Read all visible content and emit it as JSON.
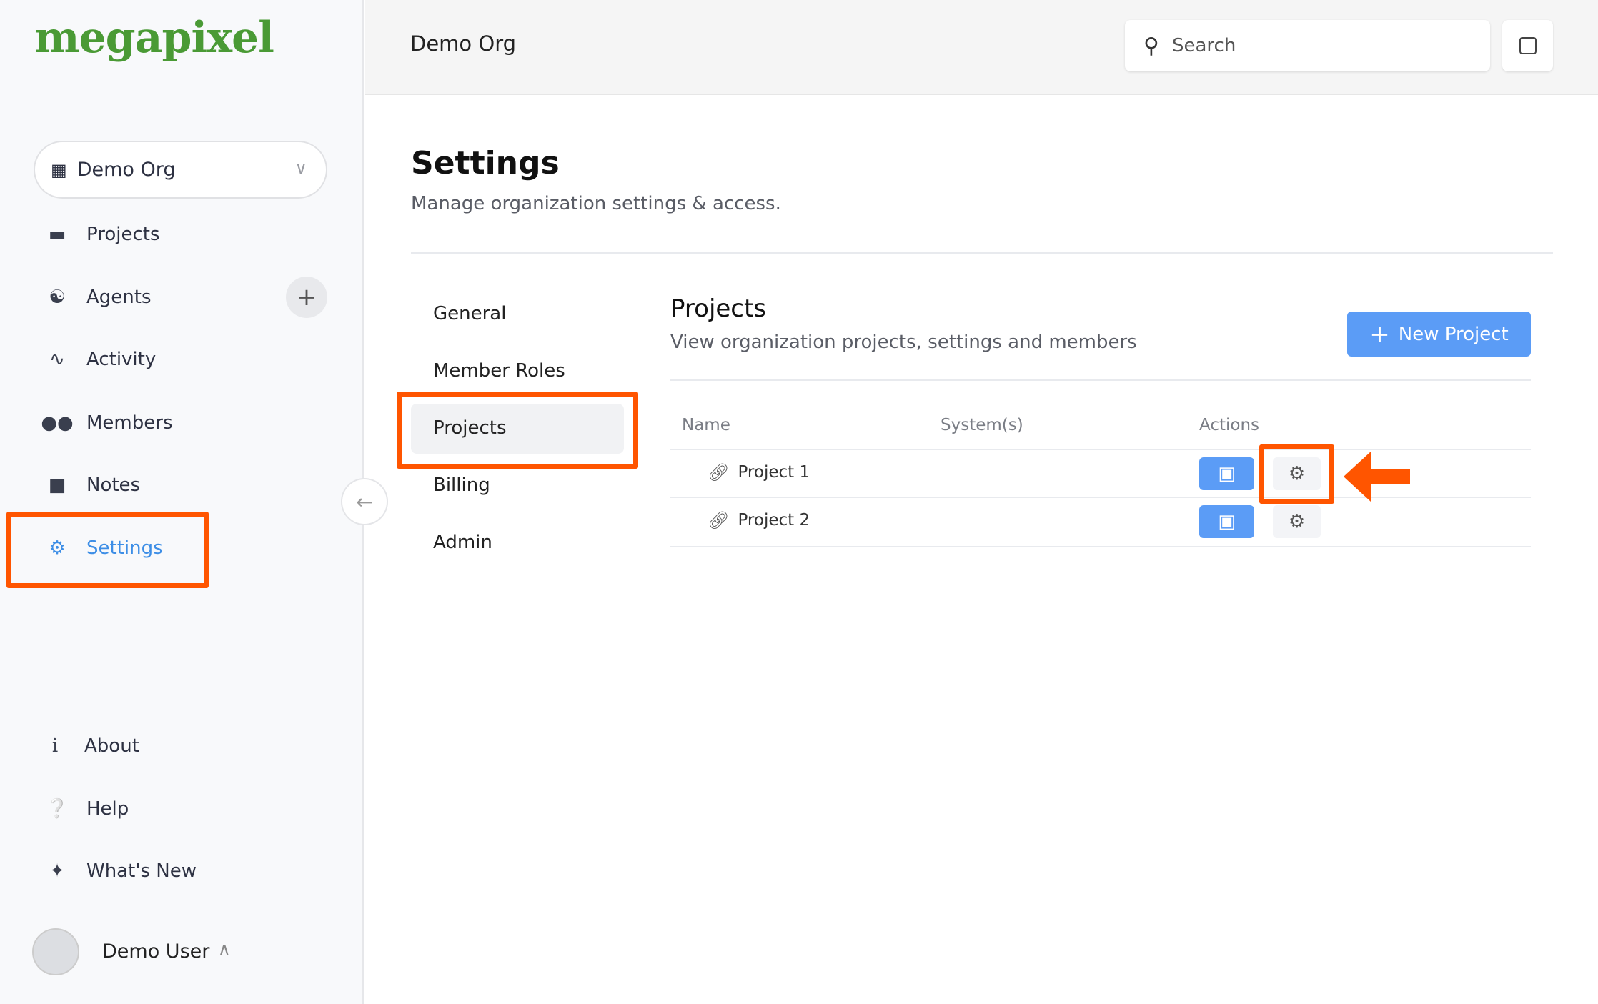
{
  "brand": {
    "logo": "megapixel",
    "color": "#4a9a35"
  },
  "sidebar": {
    "org_selector": {
      "label": "Demo Org",
      "icon": "building-icon"
    },
    "items": [
      {
        "label": "Projects",
        "icon": "folder-icon"
      },
      {
        "label": "Agents",
        "icon": "antenna-icon"
      },
      {
        "label": "Activity",
        "icon": "pulse-icon"
      },
      {
        "label": "Members",
        "icon": "users-icon"
      },
      {
        "label": "Notes",
        "icon": "note-icon"
      },
      {
        "label": "Settings",
        "icon": "gear-icon",
        "active": true
      }
    ],
    "bottom": [
      {
        "label": "About",
        "icon": "info-icon"
      },
      {
        "label": "Help",
        "icon": "help-icon"
      },
      {
        "label": "What's New",
        "icon": "sparkles-icon"
      }
    ],
    "user": {
      "name": "Demo User"
    }
  },
  "header": {
    "title": "Demo Org",
    "search_placeholder": "Search"
  },
  "page": {
    "title": "Settings",
    "subtitle": "Manage organization settings & access."
  },
  "settings_nav": [
    "General",
    "Member Roles",
    "Projects",
    "Billing",
    "Admin"
  ],
  "projects": {
    "title": "Projects",
    "subtitle": "View organization projects, settings and members",
    "new_button": "New Project",
    "columns": [
      "Name",
      "System(s)",
      "Actions"
    ],
    "rows": [
      {
        "name": "Project 1",
        "systems": ""
      },
      {
        "name": "Project 2",
        "systems": ""
      }
    ]
  },
  "colors": {
    "accent": "#5b9cf6",
    "highlight": "#ff5500",
    "active_nav": "#3d8ee6"
  }
}
